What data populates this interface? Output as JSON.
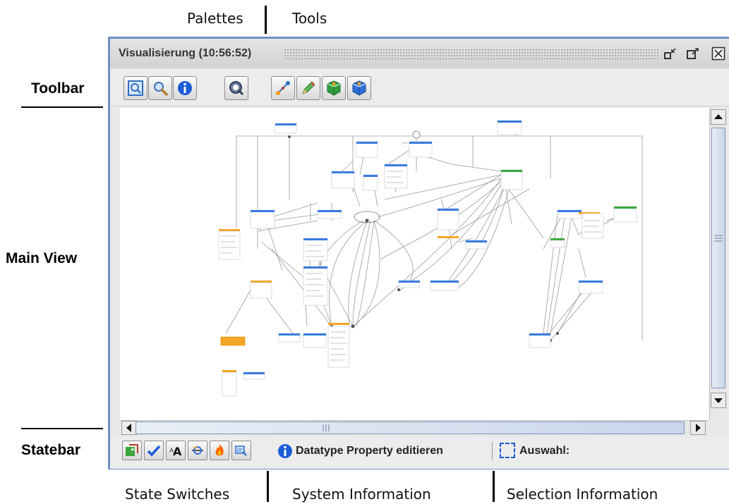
{
  "annotations": {
    "palettes": "Palettes",
    "tools": "Tools",
    "toolbar": "Toolbar",
    "main_view": "Main View",
    "statebar": "Statebar",
    "state_switches": "State Switches",
    "system_information": "System Information",
    "selection_information": "Selection Information"
  },
  "window": {
    "title": "Visualisierung (10:56:52)",
    "controls": [
      "minimize-icon",
      "maximize-icon",
      "close-icon"
    ]
  },
  "toolbar": {
    "palettes": [
      "overview-icon",
      "zoom-icon",
      "info-icon",
      "search-layout-icon"
    ],
    "tools": [
      "connect-icon",
      "edit-pencil-icon",
      "green-cube-icon",
      "blue-cube-icon"
    ]
  },
  "statebar": {
    "state_switches": [
      "refresh-icon",
      "check-icon",
      "font-icon",
      "link-icon",
      "fire-icon",
      "filter-icon"
    ],
    "system_info": "Datatype Property editieren",
    "selection_label": "Auswahl:"
  },
  "colors": {
    "window_border": "#6f8fc8",
    "node_blue": "#3a7be0",
    "node_orange": "#f5a623",
    "node_green": "#3aa63a"
  }
}
